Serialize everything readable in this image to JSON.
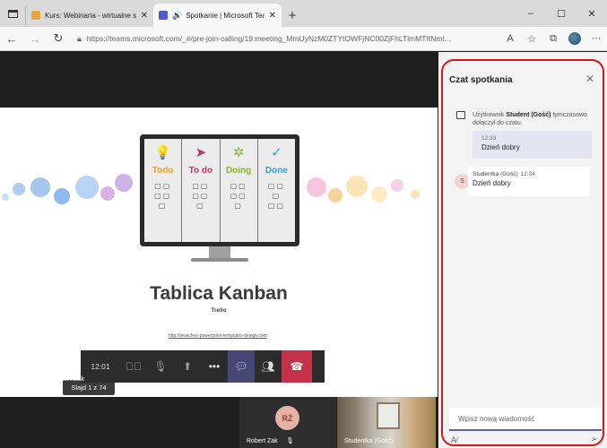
{
  "browser": {
    "tabs": [
      {
        "title": "Kurs: Webinaria - wirtualne sale",
        "active": false,
        "favicon_color": "#e8a33b"
      },
      {
        "title": "Spotkanie | Microsoft Teams",
        "active": true,
        "favicon_color": "#5059c9"
      }
    ],
    "new_tab": "+",
    "window_controls": [
      "–",
      "☐",
      "✕"
    ],
    "url": "https://teams.microsoft.com/_#/pre-join-calling/19:meeting_MmUyNzM0ZTYtOWFjNC00ZjFhLTlmMTItNml..."
  },
  "slide": {
    "kanban_columns": [
      {
        "label": "Todo",
        "color": "#e4a23a",
        "icon": "💡"
      },
      {
        "label": "To do",
        "color": "#b43b6f",
        "icon": "➤"
      },
      {
        "label": "Doing",
        "color": "#8ab33a",
        "icon": "✲"
      },
      {
        "label": "Done",
        "color": "#3a9bd9",
        "icon": "✓"
      }
    ],
    "title": "Tablica Kanban",
    "subtitle": "Trello",
    "link": "http://www.free-powerpoint-templates-design.com",
    "counter": "Slajd 1 z 74"
  },
  "call": {
    "time": "12:01",
    "presenter": "Robert Zak",
    "tiles": [
      {
        "initials": "RŻ",
        "name": "Robert Zak"
      },
      {
        "name": "Studentka (Gość)"
      }
    ]
  },
  "chat": {
    "title": "Czat spotkania",
    "system_prefix": "Użytkownik ",
    "system_name": "Student (Gość)",
    "system_suffix": " tymczasowo dołączył do czatu.",
    "messages": [
      {
        "time": "12:33",
        "text": "Dzień dobry"
      },
      {
        "author": "Studentka (Gość)",
        "time": "12:34",
        "text": "Dzień dobry",
        "initial": "S"
      }
    ],
    "compose_placeholder": "Wpisz nową wiadomość"
  }
}
